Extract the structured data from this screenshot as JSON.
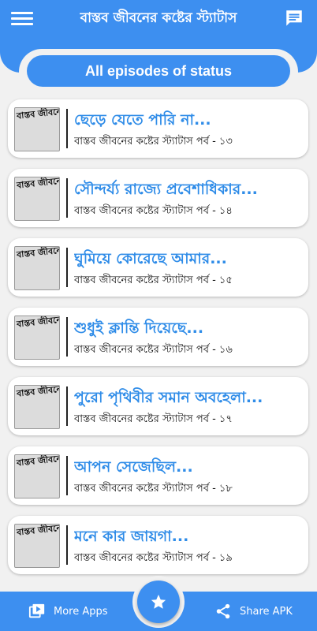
{
  "app": {
    "title": "বাস্তব জীবনের কষ্টের স্ট্যাটাস",
    "banner": "All episodes of status",
    "colors": {
      "primary": "#3d8ff0",
      "title_text": "#2f8ce8",
      "background": "#f1f1f1"
    }
  },
  "toolbar": {
    "menu_icon": "hamburger-menu",
    "message_icon": "message-bubble"
  },
  "episodes": [
    {
      "thumb": "বাস্তব জীবনের কষ্টের স্ট্যাটাস",
      "title": "ছেড়ে যেতে পারি না...",
      "subtitle": "বাস্তব জীবনের কষ্টের স্ট্যাটাস পর্ব - ১৩"
    },
    {
      "thumb": "বাস্তব জীবনের কষ্টের স্ট্যাটাস",
      "title": "সৌন্দর্য্য রাজ্যে প্রবেশাধিকার...",
      "subtitle": "বাস্তব জীবনের কষ্টের স্ট্যাটাস পর্ব - ১৪"
    },
    {
      "thumb": "বাস্তব জীবনের কষ্টের স্ট্যাটাস",
      "title": "ঘুমিয়ে কোরেছে আমার...",
      "subtitle": "বাস্তব জীবনের কষ্টের স্ট্যাটাস পর্ব - ১৫"
    },
    {
      "thumb": "বাস্তব জীবনের কষ্টের স্ট্যাটাস",
      "title": "শুধুই ক্লান্তি দিয়েছে...",
      "subtitle": "বাস্তব জীবনের কষ্টের স্ট্যাটাস পর্ব - ১৬"
    },
    {
      "thumb": "বাস্তব জীবনের কষ্টের স্ট্যাটাস",
      "title": "পুরো পৃথিবীর সমান অবহেলা...",
      "subtitle": "বাস্তব জীবনের কষ্টের স্ট্যাটাস পর্ব - ১৭"
    },
    {
      "thumb": "বাস্তব জীবনের কষ্টের স্ট্যাটাস",
      "title": "আপন সেজেছিল...",
      "subtitle": "বাস্তব জীবনের কষ্টের স্ট্যাটাস পর্ব - ১৮"
    },
    {
      "thumb": "বাস্তব জীবনের কষ্টের স্ট্যাটাস",
      "title": "মনে কার জায়গা...",
      "subtitle": "বাস্তব জীবনের কষ্টের স্ট্যাটাস পর্ব - ১৯"
    }
  ],
  "bottom_nav": {
    "more_apps": {
      "label": "More Apps",
      "icon": "video-library-icon"
    },
    "fab": {
      "icon": "star-icon"
    },
    "share_apk": {
      "label": "Share APK",
      "icon": "share-icon"
    }
  }
}
